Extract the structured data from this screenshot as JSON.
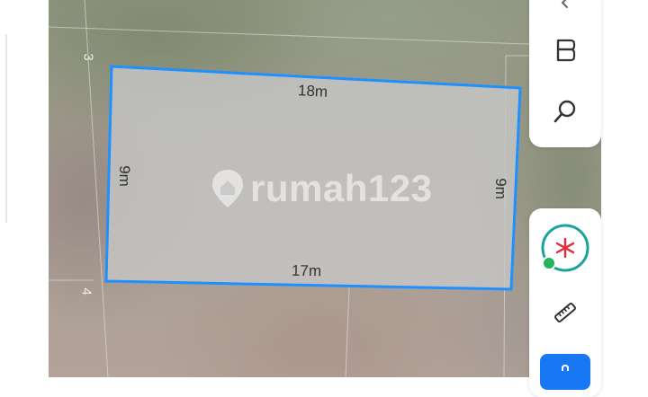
{
  "map": {
    "plot": {
      "edges": {
        "top": "18m",
        "bottom": "17m",
        "left": "9m",
        "right": "9m"
      },
      "outline_color": "#1e90ff",
      "fill_color": "#c8c8c8"
    },
    "grid_labels": {
      "top_left": "3",
      "bottom_left": "4"
    },
    "watermark": {
      "brand": "rumah123"
    }
  },
  "controls": {
    "top_panel": {
      "collapse_icon": "chevron-left-icon",
      "layers_icon": "layers-icon",
      "search_icon": "search-icon"
    },
    "bottom_panel": {
      "compass_icon": "compass-icon",
      "status_dot_color": "#20b45c",
      "measure_icon": "ruler-icon",
      "action_button_color": "#1877f2"
    }
  }
}
